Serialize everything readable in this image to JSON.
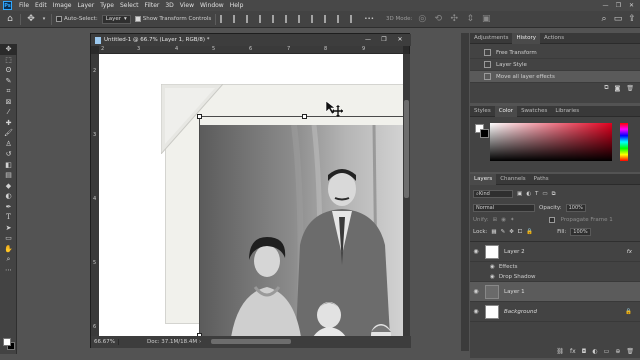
{
  "menubar": {
    "items": [
      "File",
      "Edit",
      "Image",
      "Layer",
      "Type",
      "Select",
      "Filter",
      "3D",
      "View",
      "Window",
      "Help"
    ],
    "window_controls": [
      "—",
      "❐",
      "✕"
    ]
  },
  "options_bar": {
    "auto_select_label": "Auto-Select:",
    "auto_select_value": "Layer",
    "show_transform_label": "Show Transform Controls",
    "mode_3d_label": "3D Mode:"
  },
  "document": {
    "tab_title": "Untitled-1 @ 66.7% (Layer 1, RGB/8) *",
    "window_controls": [
      "—",
      "❐",
      "✕"
    ],
    "ruler_top_numbers": [
      "2",
      "3",
      "4",
      "5",
      "6",
      "7",
      "8",
      "9"
    ],
    "ruler_left_numbers": [
      "2",
      "3",
      "4",
      "5",
      "6"
    ],
    "zoom": "66.67%",
    "doc_info": "Doc: 37.1M/18.4M"
  },
  "history_panel": {
    "tabs": [
      "Adjustments",
      "History",
      "Actions"
    ],
    "active_tab": "History",
    "items": [
      "Free Transform",
      "Layer Style",
      "Move all layer effects"
    ],
    "selected_index": 2
  },
  "color_panel": {
    "tabs": [
      "Styles",
      "Color",
      "Swatches",
      "Libraries"
    ],
    "active_tab": "Color",
    "hue_color": "#e0001e"
  },
  "layers_panel": {
    "tabs": [
      "Layers",
      "Channels",
      "Paths"
    ],
    "active_tab": "Layers",
    "filter_kind": "Kind",
    "blend_mode": "Normal",
    "opacity_label": "Opacity:",
    "opacity_value": "100%",
    "lock_label": "Lock:",
    "fill_label": "Fill:",
    "fill_value": "100%",
    "unify_label": "Unify:",
    "propagate_label": "Propagate Frame 1",
    "layers": [
      {
        "name": "Layer 2",
        "fx": "fx",
        "effects_label": "Effects",
        "effect": "Drop Shadow"
      },
      {
        "name": "Layer 1",
        "selected": true
      },
      {
        "name": "Background",
        "locked": true
      }
    ]
  },
  "colors": {
    "app_bg": "#535353",
    "panel_bg": "#434343",
    "accent": "#31a8ff"
  }
}
